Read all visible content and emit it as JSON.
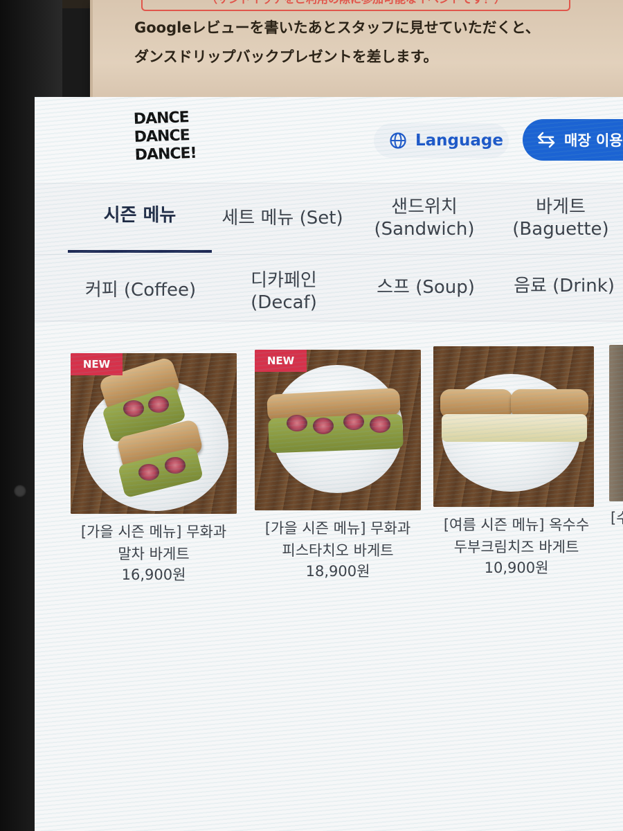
{
  "notice": {
    "cut_line": "（サンドイッチをご利用の際に参加可能なイベントです！）",
    "line1": "Googleレビューを書いたあとスタッフに見せていただくと、",
    "line2": "ダンスドリップバックプレゼントを差します。"
  },
  "header": {
    "logo_lines": [
      "DANCE",
      "DANCE",
      "DANCE!"
    ],
    "language_label": "Language",
    "store_label": "매장 이용"
  },
  "tabs": {
    "row1": [
      {
        "label": "시즌 메뉴",
        "active": true
      },
      {
        "label": "세트 메뉴 (Set)"
      },
      {
        "label": "샌드위치",
        "sub": "(Sandwich)"
      },
      {
        "label": "바게트",
        "sub": "(Baguette)"
      }
    ],
    "row2": [
      {
        "label": "커피 (Coffee)"
      },
      {
        "label": "디카페인",
        "sub": "(Decaf)"
      },
      {
        "label": "스프 (Soup)"
      },
      {
        "label": "음료 (Drink)"
      }
    ]
  },
  "menu": [
    {
      "badge": "NEW",
      "name_line1": "[가을 시즌 메뉴] 무화과",
      "name_line2": "말차 바게트",
      "price": "16,900원"
    },
    {
      "badge": "NEW",
      "name_line1": "[가을 시즌 메뉴] 무화과",
      "name_line2": "피스타치오 바게트",
      "price": "18,900원"
    },
    {
      "badge": "",
      "name_line1": "[여름 시즌 메뉴] 옥수수",
      "name_line2": "두부크림치즈 바게트",
      "price": "10,900원"
    }
  ],
  "peek_text": "[수",
  "icons": {
    "language": "globe-icon",
    "store": "swap-arrows-icon"
  },
  "colors": {
    "accent": "#1b63d3",
    "badge": "#d6314a",
    "tab_active": "#1f2a55"
  }
}
